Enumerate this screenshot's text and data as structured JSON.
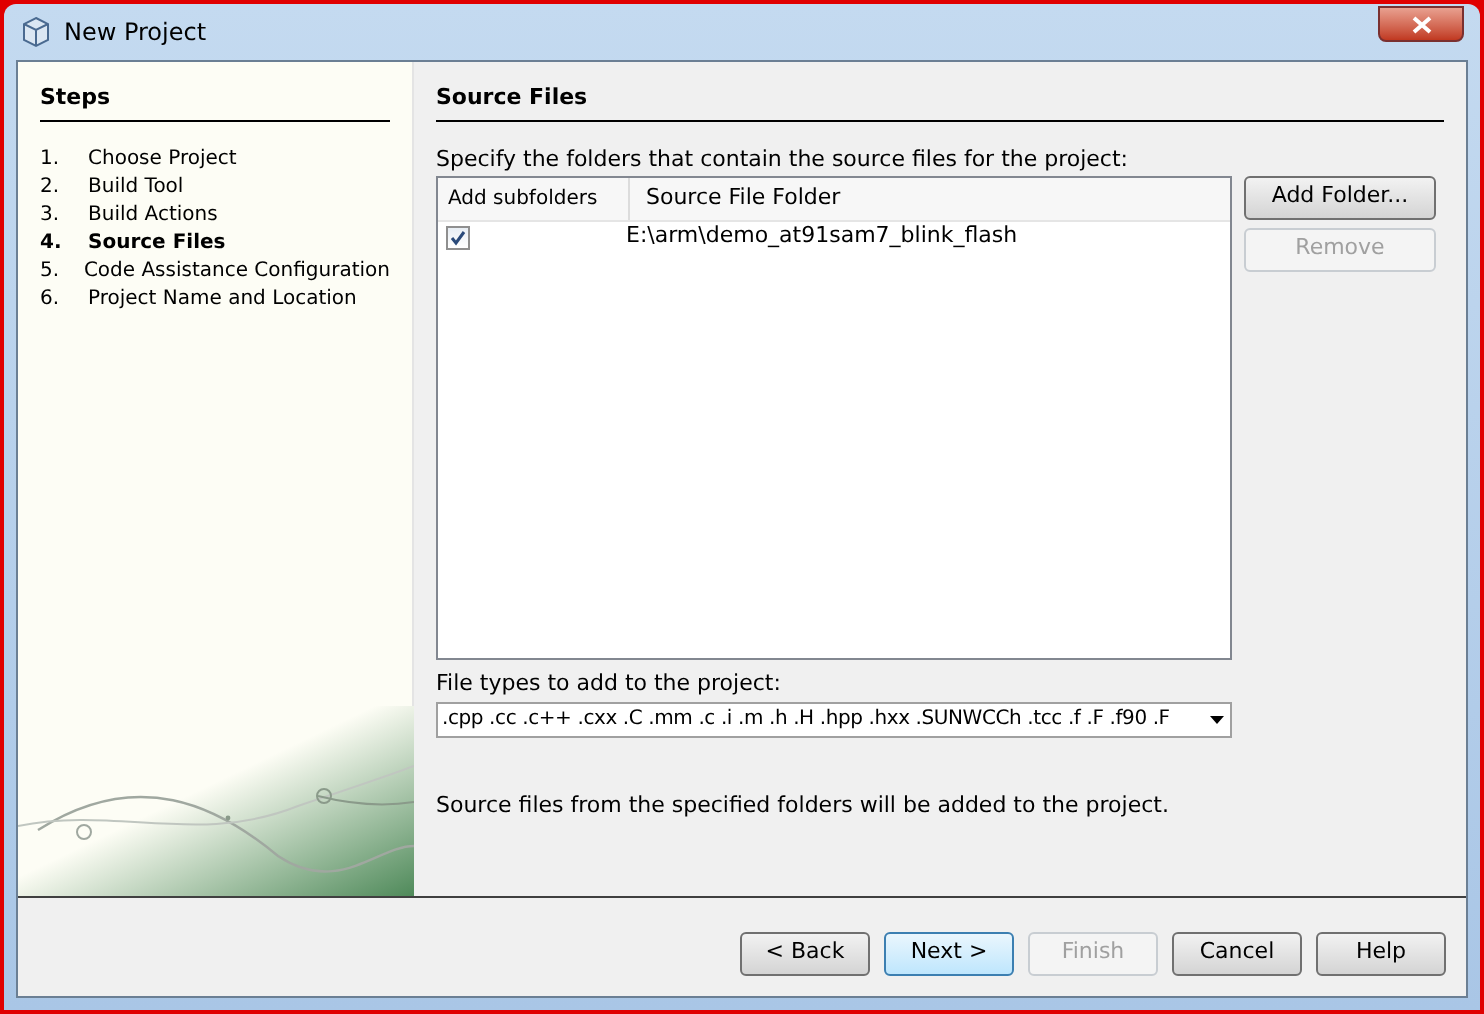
{
  "window": {
    "title": "New Project"
  },
  "steps": {
    "title": "Steps",
    "items": [
      {
        "number": "1.",
        "label": "Choose Project",
        "selected": false
      },
      {
        "number": "2.",
        "label": "Build Tool",
        "selected": false
      },
      {
        "number": "3.",
        "label": "Build Actions",
        "selected": false
      },
      {
        "number": "4.",
        "label": "Source Files",
        "selected": true
      },
      {
        "number": "5.",
        "label": "Code Assistance Configuration",
        "selected": false
      },
      {
        "number": "6.",
        "label": "Project Name and Location",
        "selected": false
      }
    ]
  },
  "panel": {
    "title": "Source Files",
    "instruction": "Specify the folders that contain the source files for the project:",
    "table": {
      "columns": [
        "Add subfolders",
        "Source File Folder"
      ],
      "rows": [
        {
          "add_subfolders": true,
          "folder": "E:\\arm\\demo_at91sam7_blink_flash"
        }
      ]
    },
    "side_buttons": [
      {
        "label": "Add Folder...",
        "disabled": false
      },
      {
        "label": "Remove",
        "disabled": true
      }
    ],
    "file_types_label": "File types to add to the project:",
    "file_types_value": ".cpp .cc .c++ .cxx .C .mm .c .i .m .h .H .hpp .hxx .SUNWCCh .tcc .f .F .f90 .F",
    "note": "Source files from the specified folders will be added to the project."
  },
  "buttons": [
    {
      "label": "< Back",
      "disabled": false,
      "default": false
    },
    {
      "label": "Next >",
      "disabled": false,
      "default": true
    },
    {
      "label": "Finish",
      "disabled": true,
      "default": false
    },
    {
      "label": "Cancel",
      "disabled": false,
      "default": false
    },
    {
      "label": "Help",
      "disabled": false,
      "default": false
    }
  ]
}
